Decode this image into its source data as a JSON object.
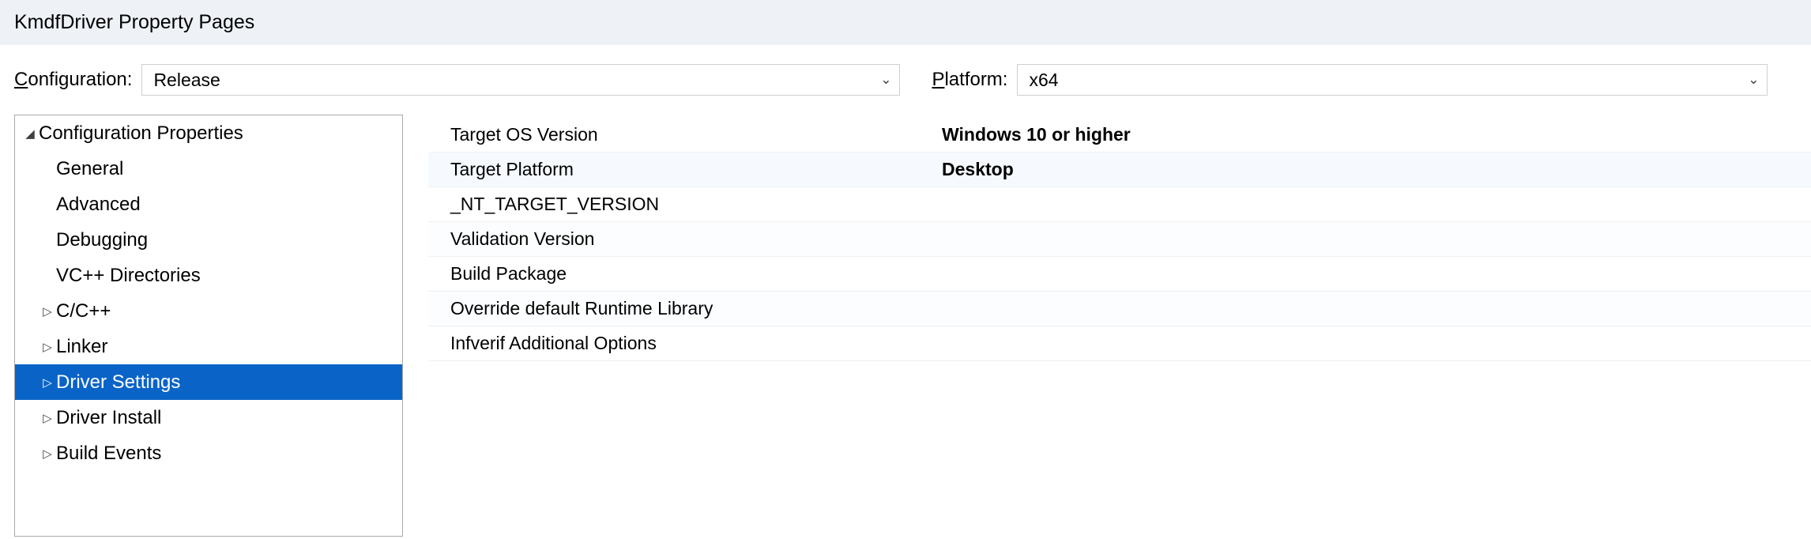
{
  "title": "KmdfDriver Property Pages",
  "configuration": {
    "label": "onfiguration:",
    "prefix": "C",
    "value": "Release"
  },
  "platform": {
    "label": "latform:",
    "prefix": "P",
    "value": "x64"
  },
  "tree": {
    "root": "Configuration Properties",
    "items": [
      {
        "label": "General",
        "expandable": false
      },
      {
        "label": "Advanced",
        "expandable": false
      },
      {
        "label": "Debugging",
        "expandable": false
      },
      {
        "label": "VC++ Directories",
        "expandable": false
      },
      {
        "label": "C/C++",
        "expandable": true
      },
      {
        "label": "Linker",
        "expandable": true
      },
      {
        "label": "Driver Settings",
        "expandable": true,
        "selected": true
      },
      {
        "label": "Driver Install",
        "expandable": true
      },
      {
        "label": "Build Events",
        "expandable": true
      }
    ]
  },
  "props": [
    {
      "label": "Target OS Version",
      "value": "Windows 10 or higher"
    },
    {
      "label": "Target Platform",
      "value": "Desktop"
    },
    {
      "label": "_NT_TARGET_VERSION",
      "value": ""
    },
    {
      "label": "Validation Version",
      "value": ""
    },
    {
      "label": "Build Package",
      "value": ""
    },
    {
      "label": "Override default Runtime Library",
      "value": ""
    },
    {
      "label": "Infverif Additional Options",
      "value": ""
    }
  ]
}
